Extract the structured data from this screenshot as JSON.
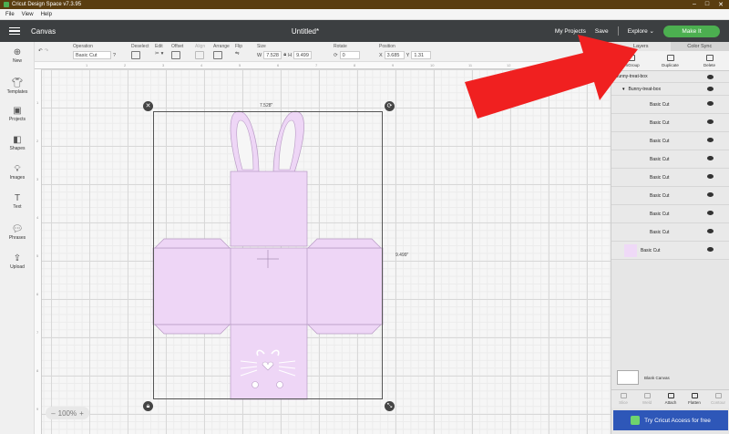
{
  "titlebar": {
    "title": "Cricut Design Space  v7.3.95",
    "controls": [
      "–",
      "□",
      "✕"
    ]
  },
  "menubar": {
    "items": [
      "File",
      "View",
      "Help"
    ]
  },
  "header": {
    "canvas_label": "Canvas",
    "doc_title": "Untitled*",
    "my_projects": "My Projects",
    "save": "Save",
    "explore": "Explore",
    "make_it": "Make It",
    "accent": "#4caf50"
  },
  "toolbar": {
    "operation_label": "Operation",
    "operation_value": "Basic Cut",
    "deselect_label": "Deselect",
    "edit_label": "Edit",
    "offset_label": "Offset",
    "align_label": "Align",
    "arrange_label": "Arrange",
    "flip_label": "Flip",
    "size_label": "Size",
    "size_w_label": "W",
    "size_w_value": "7.528",
    "size_h_label": "H",
    "size_h_value": "9.499",
    "rotate_label": "Rotate",
    "rotate_value": "0",
    "position_label": "Position",
    "pos_x_label": "X",
    "pos_x_value": "3.685",
    "pos_y_label": "Y",
    "pos_y_value": "1.31"
  },
  "leftbar": {
    "items": [
      {
        "label": "New",
        "icon": "plus-icon"
      },
      {
        "label": "Templates",
        "icon": "shirt-icon"
      },
      {
        "label": "Projects",
        "icon": "projects-icon"
      },
      {
        "label": "Shapes",
        "icon": "shapes-icon"
      },
      {
        "label": "Images",
        "icon": "bulb-icon"
      },
      {
        "label": "Text",
        "icon": "text-icon"
      },
      {
        "label": "Phrases",
        "icon": "phrases-icon"
      },
      {
        "label": "Upload",
        "icon": "upload-icon"
      }
    ]
  },
  "canvas": {
    "width_label": "7.528\"",
    "height_label": "9.499\"",
    "zoom": "100%",
    "zoom_minus": "–",
    "zoom_plus": "+",
    "ruler_numbers": [
      "1",
      "2",
      "3",
      "4",
      "5",
      "6",
      "7",
      "8",
      "9",
      "10",
      "11",
      "12",
      "13",
      "14"
    ],
    "object_color": "#eed6f6",
    "object_stroke": "#b79ac4"
  },
  "rightpanel": {
    "tabs": [
      "Layers",
      "Color Sync"
    ],
    "actions": [
      "UnGroup",
      "Duplicate",
      "Delete"
    ],
    "layers": [
      {
        "name": "Bunny-treat-box",
        "level": "group"
      },
      {
        "name": "Bunny-treat-box",
        "level": "subgroup"
      },
      {
        "name": "Basic Cut",
        "level": "item"
      },
      {
        "name": "Basic Cut",
        "level": "item"
      },
      {
        "name": "Basic Cut",
        "level": "item"
      },
      {
        "name": "Basic Cut",
        "level": "item"
      },
      {
        "name": "Basic Cut",
        "level": "item"
      },
      {
        "name": "Basic Cut",
        "level": "item"
      },
      {
        "name": "Basic Cut",
        "level": "item"
      },
      {
        "name": "Basic Cut",
        "level": "item"
      },
      {
        "name": "Basic Cut",
        "level": "thumb"
      }
    ],
    "blank_canvas": "Blank Canvas",
    "bottom_actions": [
      "Slice",
      "Weld",
      "Attach",
      "Flatten",
      "Contour"
    ],
    "cricut_access": "Try Cricut Access for free",
    "access_color": "#2e57b8"
  }
}
